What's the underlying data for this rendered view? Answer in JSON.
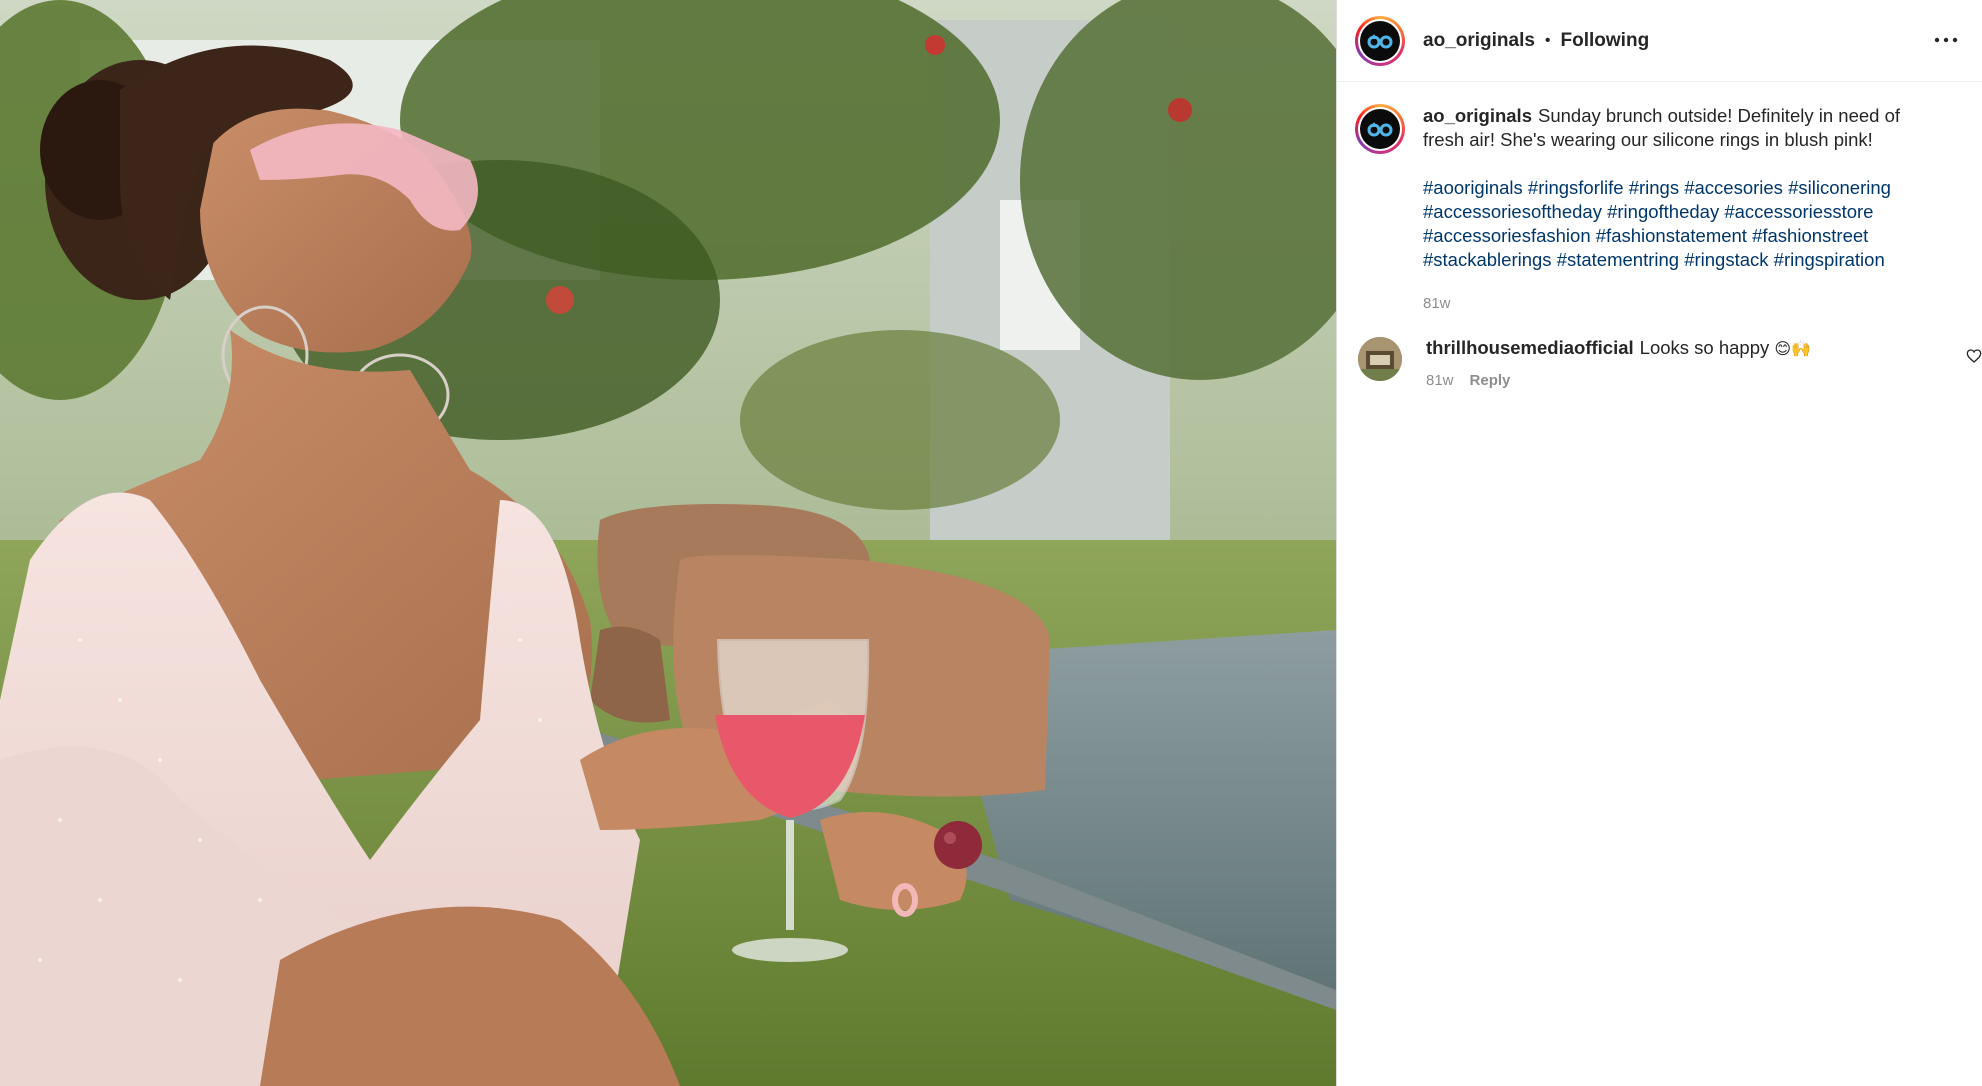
{
  "post": {
    "author": {
      "username": "ao_originals",
      "avatar_icon": "ao-originals-logo-icon"
    },
    "header": {
      "separator": "•",
      "follow_status": "Following",
      "more_icon": "more-options-icon"
    },
    "caption": {
      "username": "ao_originals",
      "text": "Sunday brunch outside! Definitely in need of fresh air! She's wearing our silicone rings in blush pink!",
      "hashtags": [
        "#aooriginals",
        "#ringsforlife",
        "#rings",
        "#accesories",
        "#siliconering",
        "#accessoriesoftheday",
        "#ringoftheday",
        "#accessoriesstore",
        "#accessoriesfashion",
        "#fashionstatement",
        "#fashionstreet",
        "#stackablerings",
        "#statementring",
        "#ringstack",
        "#ringspiration"
      ],
      "timestamp": "81w"
    },
    "comments": [
      {
        "username": "thrillhousemediaofficial",
        "text": "Looks so happy",
        "emoji": "😊🙌",
        "timestamp": "81w",
        "reply_label": "Reply",
        "like_icon": "heart-outline-icon"
      }
    ],
    "image": {
      "icon": "post-photo",
      "accent_colors": {
        "dress": "#f2dcd8",
        "glasses": "#f4b8c4",
        "wine": "#e8586a",
        "grass": "#7c9a3e"
      }
    },
    "colors": {
      "text": "#262626",
      "hashtag": "#00376b",
      "muted": "#8e8e8e",
      "border": "#dbdbdb"
    }
  }
}
